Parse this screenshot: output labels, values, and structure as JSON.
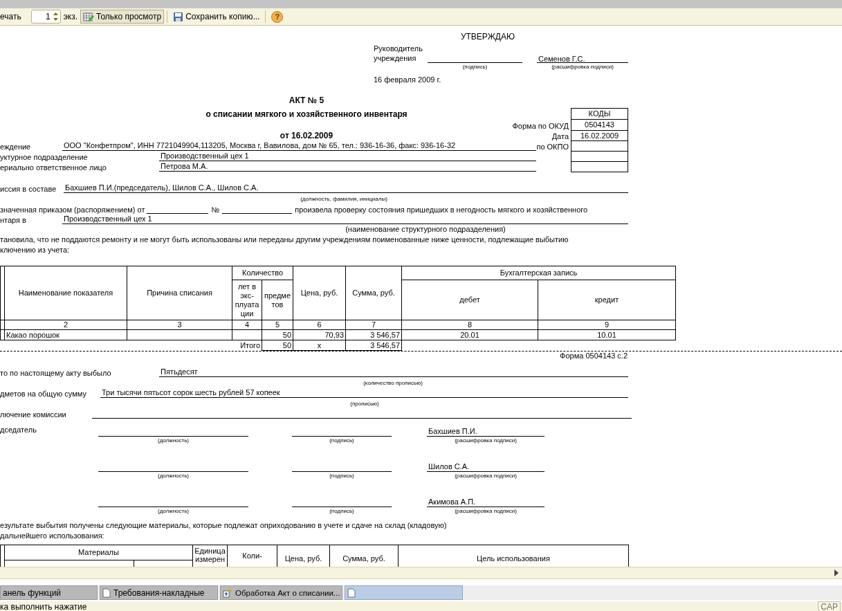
{
  "toolbar": {
    "print_label": "ечать",
    "copies": "1",
    "copies_unit": "экз.",
    "view_only": {
      "label": "Только просмотр",
      "selected": true
    },
    "save_copy": "Сохранить копию...",
    "help": "?"
  },
  "approval": {
    "heading": "УТВЕРЖДАЮ",
    "position_lines": [
      "Руководитель",
      "учреждения"
    ],
    "signature_caption": "(подпись)",
    "name": "Семенов Г.С.",
    "name_caption": "(расшифровка подписи)",
    "date": "16 февраля 2009 г."
  },
  "title": "АКТ № 5",
  "subtitle": "о списании мягкого и хозяйственного инвентаря",
  "date_line": "от 16.02.2009",
  "codes": {
    "header": "КОДЫ",
    "rows": [
      {
        "label": "Форма  по ОКУД",
        "value": "0504143"
      },
      {
        "label": "Дата",
        "value": "16.02.2009"
      },
      {
        "label": "по ОКПО"
      }
    ]
  },
  "fields": [
    {
      "label": "еждение",
      "value": "ООО \"Конфетпром\", ИНН 7721049904,113205, Москва г, Вавилова, дом № 65, тел.: 936-16-36, факс: 936-16-32"
    },
    {
      "label": "уктурное подразделение",
      "value": "Производственный цех 1"
    },
    {
      "label": "ериально ответственное лицо",
      "value": "Петрова М.А."
    }
  ],
  "commission": {
    "label": "иссия в составе",
    "value": "Бахшиев П.И.(председатель),  Шилов С.А.,  Шилов С.А.",
    "caption": "(должность, фамилия, инициалы)"
  },
  "order": {
    "start": "значенная приказом (распоряжением) от",
    "number_sign": "№",
    "rest": "произвела проверку состояния пришедших в негодность мягкого и хозяйственного",
    "place_label": "нтаря в",
    "place_value": "Производственный цех 1",
    "place_caption": "(наименование структурного подразделения)"
  },
  "finding_lines": [
    "тановила, что не поддаются ремонту и не могут быть использованы или переданы другим учреждениям поименованные ниже ценности, подлежащие выбытию",
    "ключению из учета:"
  ],
  "writeoff_table": {
    "headers": {
      "name": "Наименование показателя",
      "reason": "Причина списания",
      "quantity": "Количество",
      "years": "лет в экс-плуата ции",
      "items": "предме тов",
      "price": "Цена, руб.",
      "sum": "Сумма, руб.",
      "accounting": "Бухгалтерская запись",
      "debit": "дебет",
      "credit": "кредит"
    },
    "numbers": [
      "2",
      "3",
      "4",
      "5",
      "6",
      "7",
      "8",
      "9"
    ],
    "rows": [
      {
        "name": "Какао порошок",
        "items": "50",
        "price": "70,93",
        "sum": "3 546,57",
        "debit": "20.01",
        "credit": "10.01"
      }
    ],
    "total": {
      "label": "Итого",
      "items": "50",
      "price": "х",
      "sum": "3 546,57"
    }
  },
  "page_label": "Форма 0504143  с.2",
  "summary": [
    {
      "label": "то по настоящему акту выбыло",
      "value": "Пятьдесят",
      "caption": "(количество прописью)"
    },
    {
      "label": "дметов на общую сумму",
      "value": "Три тысячи пятьсот сорок шесть рублей 57 копеек",
      "caption": "(прописью)"
    },
    {
      "label": "лючение комиссии"
    }
  ],
  "signatures": {
    "role": "дседатель",
    "rows": [
      {
        "position_caption": "(должность)",
        "signature_caption": "(подпись)",
        "name": "Бахшиев П.И.",
        "name_caption": "(расшифровка подписи)"
      },
      {
        "position_caption": "(должность)",
        "signature_caption": "(подпись)",
        "name": "Шилов С.А.",
        "name_caption": "(расшифровка подписи)"
      },
      {
        "position_caption": "(должность)",
        "signature_caption": "(подпись)",
        "name": "Акимова А.П.",
        "name_caption": "(расшифровка подписи)"
      }
    ]
  },
  "materials_lines": [
    "езультате выбытия получены следующие материалы, которые подлежат оприходованию в учете и сдаче на склад (кладовую)",
    "дальнейшего использования:"
  ],
  "materials_table": {
    "headers": {
      "materials": "Материалы",
      "unit": "Единица измерен",
      "quantity": "Коли-",
      "price": "Цена, руб.",
      "sum": "Сумма, руб.",
      "purpose": "Цель использования"
    }
  },
  "taskbar": [
    {
      "label": "анель функций",
      "kind": "plain",
      "selected": false
    },
    {
      "label": "Требования-накладные",
      "kind": "document",
      "selected": false
    },
    {
      "label": "Обработка  Акт о списании...",
      "kind": "processing",
      "selected": false
    },
    {
      "kind": "document",
      "selected": true
    }
  ],
  "status_bar": {
    "message": "ка выполнить нажатие",
    "indicator": "CAP"
  }
}
